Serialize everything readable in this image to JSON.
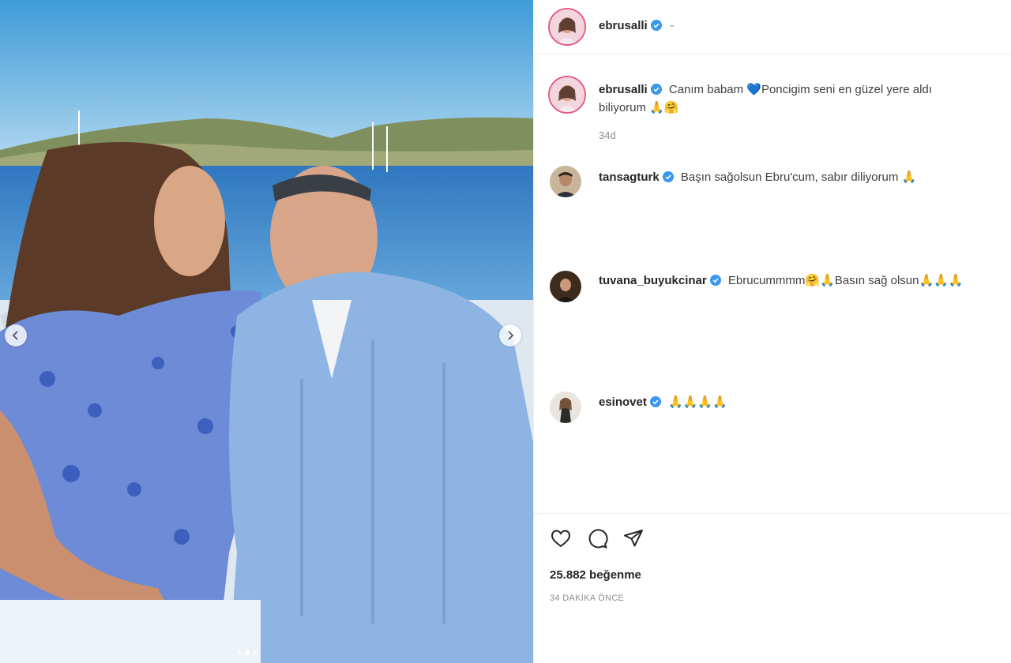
{
  "post": {
    "owner": "ebrusalli",
    "owner_separator": "-",
    "caption": {
      "username": "ebrusalli",
      "text_part1": "Canım babam",
      "heart_emoji": "💙",
      "text_part2": "Poncigim seni en güzel yere aldı biliyorum",
      "emojis": "🙏🤗",
      "age": "34d"
    },
    "comments": [
      {
        "username": "tansagturk",
        "text": "Başın sağolsun Ebru'cum, sabır diliyorum",
        "emojis": "🙏"
      },
      {
        "username": "tuvana_buyukcinar",
        "text": "Ebrucummmm🤗🙏Basın sağ olsun🙏🙏🙏",
        "emojis": ""
      },
      {
        "username": "esinovet",
        "text": "",
        "emojis": "🙏🙏🙏🙏"
      }
    ],
    "likes": "25.882 beğenme",
    "timestamp": "34 DAKİKA ÖNCE",
    "carousel": {
      "total": 3,
      "active": 1
    }
  },
  "colors": {
    "verified": "#3897f0",
    "story_ring": "#e35d8b"
  },
  "icons": {
    "like": "heart-outline-icon",
    "comment": "speech-bubble-icon",
    "share": "paper-plane-icon",
    "prev": "chevron-left-icon",
    "next": "chevron-right-icon"
  }
}
